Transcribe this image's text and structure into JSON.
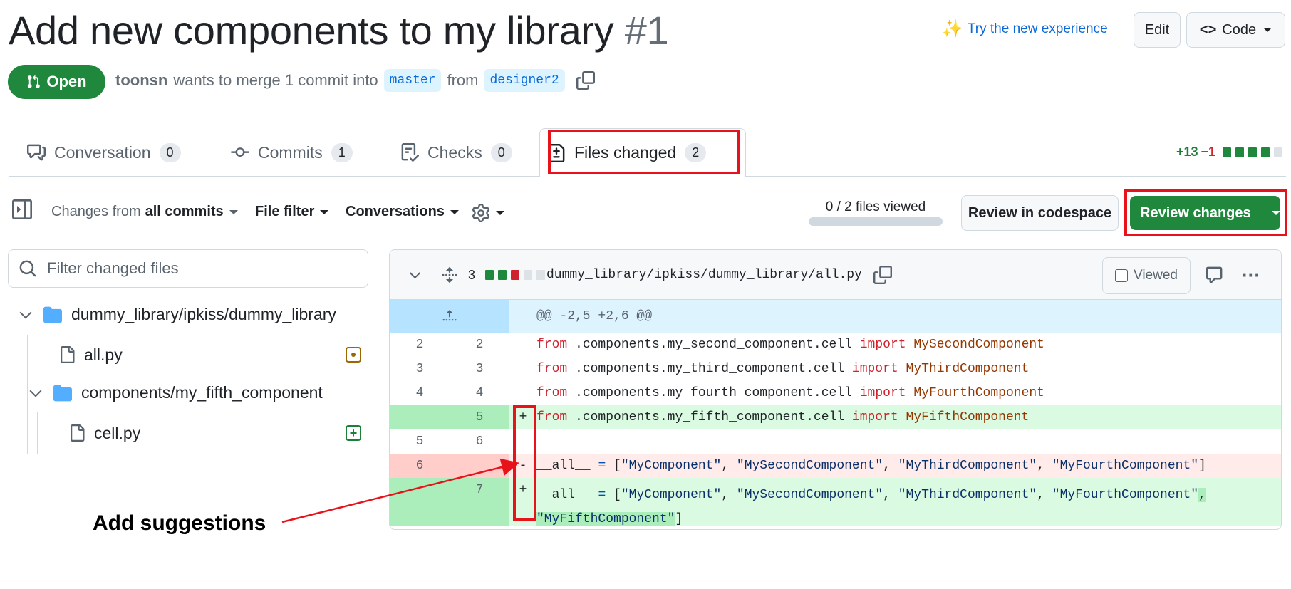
{
  "header": {
    "title": "Add new components to my library",
    "number": "#1",
    "state": "Open",
    "author": "toonsn",
    "merge_text": "wants to merge 1 commit into",
    "base_branch": "master",
    "from_text": "from",
    "head_branch": "designer2",
    "try_experience": "Try the new experience",
    "edit_label": "Edit",
    "code_label": "Code"
  },
  "tabs": [
    {
      "label": "Conversation",
      "count": "0"
    },
    {
      "label": "Commits",
      "count": "1"
    },
    {
      "label": "Checks",
      "count": "0"
    },
    {
      "label": "Files changed",
      "count": "2"
    }
  ],
  "diffstat": {
    "additions": "+13",
    "deletions": "−1"
  },
  "toolbar": {
    "changes_from": "Changes from",
    "all_commits": "all commits",
    "file_filter": "File filter",
    "conversations": "Conversations",
    "files_viewed": "0 / 2 files viewed",
    "review_codespace": "Review in codespace",
    "review_changes": "Review changes"
  },
  "sidebar": {
    "filter_placeholder": "Filter changed files",
    "tree": [
      {
        "type": "folder",
        "name": "dummy_library/ipkiss/dummy_library"
      },
      {
        "type": "file",
        "name": "all.py",
        "status": "modified"
      },
      {
        "type": "folder",
        "name": "components/my_fifth_component"
      },
      {
        "type": "file",
        "name": "cell.py",
        "status": "added"
      }
    ]
  },
  "diff": {
    "changes_count": "3",
    "file_path": "dummy_library/ipkiss/dummy_library/all.py",
    "viewed_label": "Viewed",
    "hunk_header": "@@ -2,5 +2,6 @@",
    "lines": [
      {
        "old": "2",
        "new": "2",
        "mark": "",
        "kind": "ctx",
        "module": ".components.my_second_component.cell",
        "name": "MySecondComponent"
      },
      {
        "old": "3",
        "new": "3",
        "mark": "",
        "kind": "ctx",
        "module": ".components.my_third_component.cell",
        "name": "MyThirdComponent"
      },
      {
        "old": "4",
        "new": "4",
        "mark": "",
        "kind": "ctx",
        "module": ".components.my_fourth_component.cell",
        "name": "MyFourthComponent"
      },
      {
        "old": "",
        "new": "5",
        "mark": "+",
        "kind": "add",
        "module": ".components.my_fifth_component.cell",
        "name": "MyFifthComponent"
      },
      {
        "old": "5",
        "new": "6",
        "mark": "",
        "kind": "ctx"
      },
      {
        "old": "6",
        "new": "",
        "mark": "-",
        "kind": "del"
      },
      {
        "old": "",
        "new": "7",
        "mark": "+",
        "kind": "add"
      }
    ],
    "kw_from": "from",
    "kw_import": "import",
    "all_var": "__all__",
    "eq": "=",
    "list_strings": [
      "\"MyComponent\"",
      "\"MySecondComponent\"",
      "\"MyThirdComponent\"",
      "\"MyFourthComponent\""
    ],
    "extra_string": "\"MyFifthComponent\""
  },
  "annotation": "Add suggestions",
  "colors": {
    "accent_red": "#e8131a",
    "green": "#1f883d",
    "link": "#0969da"
  }
}
